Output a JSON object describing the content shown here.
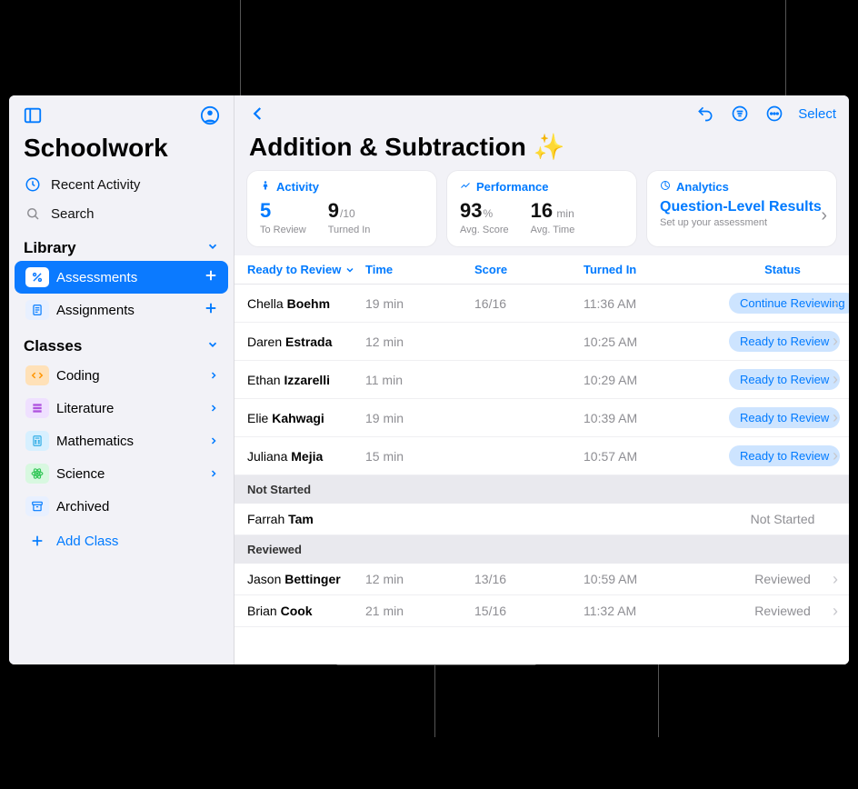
{
  "app": {
    "title": "Schoolwork"
  },
  "sidebar": {
    "nav": [
      {
        "icon": "clock-icon",
        "label": "Recent Activity"
      },
      {
        "icon": "search-icon",
        "label": "Search"
      }
    ],
    "sections": {
      "library": {
        "title": "Library",
        "items": [
          {
            "icon": "percent-icon",
            "label": "Assessments",
            "trail": "plus",
            "active": true,
            "bg": "#0b7aff",
            "fg": "#ffffff"
          },
          {
            "icon": "doc-icon",
            "label": "Assignments",
            "trail": "plus",
            "bg": "#e8f0ff",
            "fg": "#007aff"
          }
        ]
      },
      "classes": {
        "title": "Classes",
        "items": [
          {
            "icon": "code-icon",
            "label": "Coding",
            "bg": "#ffe1b8",
            "fg": "#ff9500"
          },
          {
            "icon": "book-icon",
            "label": "Literature",
            "bg": "#efe0ff",
            "fg": "#af52de"
          },
          {
            "icon": "calc-icon",
            "label": "Mathematics",
            "bg": "#d7f0ff",
            "fg": "#32ade6"
          },
          {
            "icon": "atom-icon",
            "label": "Science",
            "bg": "#d8f8e0",
            "fg": "#34c759"
          }
        ]
      },
      "other": [
        {
          "icon": "archive-icon",
          "label": "Archived",
          "bg": "#e8f0ff",
          "fg": "#007aff"
        }
      ]
    },
    "addClass": "Add Class"
  },
  "toolbar": {
    "select": "Select"
  },
  "page": {
    "title": "Addition & Subtraction ✨"
  },
  "cards": {
    "activity": {
      "label": "Activity",
      "toReview": {
        "value": "5",
        "sub": "To Review"
      },
      "turnedIn": {
        "value": "9",
        "unit": "/10",
        "sub": "Turned In"
      }
    },
    "performance": {
      "label": "Performance",
      "avgScore": {
        "value": "93",
        "unit": "%",
        "sub": "Avg. Score"
      },
      "avgTime": {
        "value": "16",
        "unit": " min",
        "sub": "Avg. Time"
      }
    },
    "analytics": {
      "label": "Analytics",
      "title": "Question-Level Results",
      "sub": "Set up your assessment"
    }
  },
  "table": {
    "headers": {
      "c1": "Ready to Review",
      "c2": "Time",
      "c3": "Score",
      "c4": "Turned In",
      "c5": "Status"
    },
    "groups": [
      {
        "header": null,
        "rows": [
          {
            "first": "Chella",
            "last": "Boehm",
            "time": "19 min",
            "score": "16/16",
            "turned": "11:36 AM",
            "status": "Continue Reviewing",
            "pill": true
          },
          {
            "first": "Daren",
            "last": "Estrada",
            "time": "12 min",
            "score": "",
            "turned": "10:25 AM",
            "status": "Ready to Review",
            "pill": true
          },
          {
            "first": "Ethan",
            "last": "Izzarelli",
            "time": "11 min",
            "score": "",
            "turned": "10:29 AM",
            "status": "Ready to Review",
            "pill": true
          },
          {
            "first": "Elie",
            "last": "Kahwagi",
            "time": "19 min",
            "score": "",
            "turned": "10:39 AM",
            "status": "Ready to Review",
            "pill": true
          },
          {
            "first": "Juliana",
            "last": "Mejia",
            "time": "15 min",
            "score": "",
            "turned": "10:57 AM",
            "status": "Ready to Review",
            "pill": true
          }
        ]
      },
      {
        "header": "Not Started",
        "rows": [
          {
            "first": "Farrah",
            "last": "Tam",
            "time": "",
            "score": "",
            "turned": "",
            "status": "Not Started",
            "pill": false,
            "nochev": true
          }
        ]
      },
      {
        "header": "Reviewed",
        "rows": [
          {
            "first": "Jason",
            "last": "Bettinger",
            "time": "12 min",
            "score": "13/16",
            "turned": "10:59 AM",
            "status": "Reviewed",
            "pill": false
          },
          {
            "first": "Brian",
            "last": "Cook",
            "time": "21 min",
            "score": "15/16",
            "turned": "11:32 AM",
            "status": "Reviewed",
            "pill": false
          }
        ]
      }
    ]
  }
}
